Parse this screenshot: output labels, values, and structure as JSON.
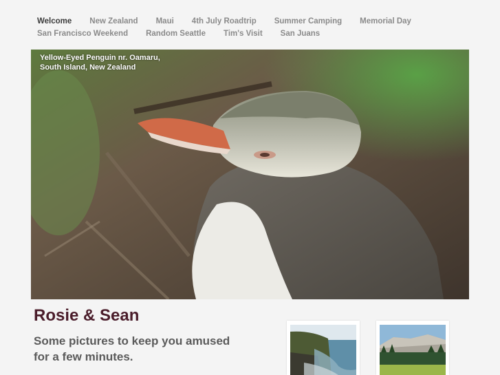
{
  "nav": {
    "row1": [
      "Welcome",
      "New Zealand",
      "Maui",
      "4th July Roadtrip",
      "Summer Camping",
      "Memorial Day"
    ],
    "row2": [
      "San Francisco Weekend",
      "Random Seattle",
      "Tim's Visit",
      "San Juans"
    ],
    "active": "Welcome"
  },
  "hero": {
    "caption_line1": "Yellow-Eyed Penguin nr. Oamaru,",
    "caption_line2": "South Island, New Zealand"
  },
  "site": {
    "title": "Rosie & Sean",
    "tagline": "Some pictures to keep you amused for a few minutes."
  },
  "thumbnails": [
    {
      "subject": "coastal cliffs"
    },
    {
      "subject": "mountain meadow"
    }
  ]
}
